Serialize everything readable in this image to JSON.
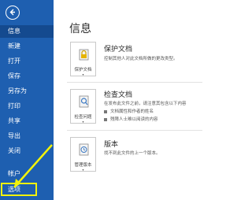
{
  "sidebar": {
    "items": [
      {
        "label": "信息"
      },
      {
        "label": "新建"
      },
      {
        "label": "打开"
      },
      {
        "label": "保存"
      },
      {
        "label": "另存为"
      },
      {
        "label": "打印"
      },
      {
        "label": "共享"
      },
      {
        "label": "导出"
      },
      {
        "label": "关闭"
      },
      {
        "label": "帐户"
      },
      {
        "label": "选项"
      }
    ]
  },
  "main": {
    "title": "信息",
    "sections": [
      {
        "card_label": "保护文档",
        "title": "保护文档",
        "lines": [
          "控制其他人对此文档所做的更改类型。"
        ]
      },
      {
        "card_label": "检查问题",
        "title": "检查文档",
        "lines": [
          "在发布此文件之前，请注意其包含以下内容"
        ],
        "bullets": [
          "文档属性和作者的姓名",
          "残障人士难以阅读的内容"
        ]
      },
      {
        "card_label": "管理版本",
        "title": "版本",
        "lines": [
          "找不到此文件的上一个版本。"
        ]
      }
    ]
  },
  "colors": {
    "sidebar_bg": "#1e5fb0",
    "sidebar_active": "#144a8f",
    "highlight": "#f2f20a"
  }
}
